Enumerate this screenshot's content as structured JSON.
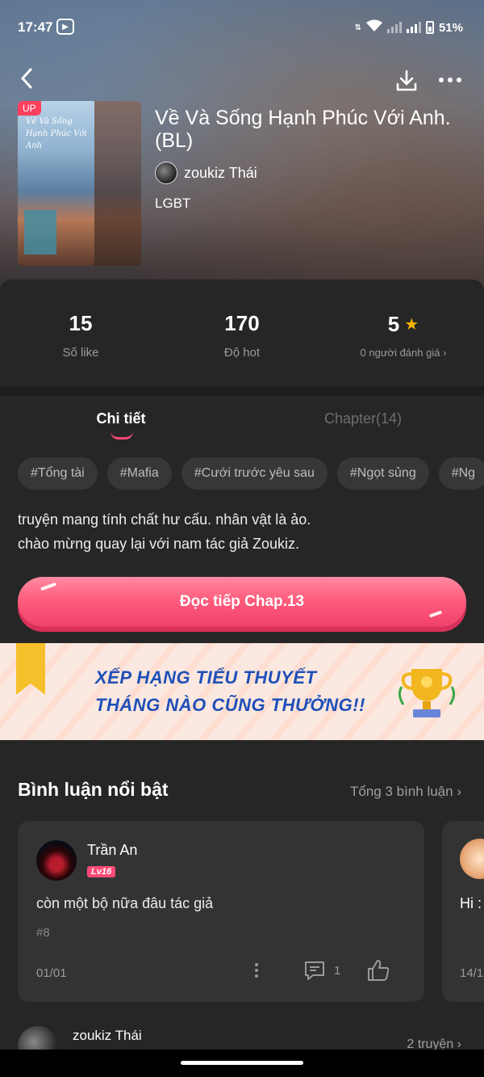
{
  "status": {
    "time": "17:47",
    "battery": "51%"
  },
  "header": {
    "back_icon": "chevron-left-icon",
    "download_icon": "download-icon",
    "more_icon": "more-dots-icon"
  },
  "story": {
    "badge": "UP",
    "cover_title": "Về Và Sống Hạnh Phúc Với Anh",
    "title": "Về Và Sống Hạnh Phúc Với Anh. (BL)",
    "author": "zoukiz Thái",
    "genre": "LGBT"
  },
  "stats": {
    "likes_value": "15",
    "likes_label": "Số like",
    "hot_value": "170",
    "hot_label": "Độ hot",
    "rating_value": "5",
    "rating_label": "0 người đánh giá",
    "star_color": "#f4b400"
  },
  "tabs": {
    "detail": "Chi tiết",
    "chapters": "Chapter(14)"
  },
  "tags": [
    "#Tổng tài",
    "#Mafia",
    "#Cưới trước yêu sau",
    "#Ngọt sủng",
    "#Ng"
  ],
  "description": {
    "line1": "truyện mang tính chất hư cấu. nhân vật là ảo.",
    "line2": "chào mừng quay lại với nam tác giả Zoukiz."
  },
  "read_button": {
    "label": "Đọc tiếp Chap.13",
    "color": "#ff5d7e"
  },
  "banner": {
    "line1": "XẾP HẠNG TIỂU THUYẾT",
    "line2": "THÁNG NÀO CŨNG THƯỞNG!!"
  },
  "comments": {
    "section_title": "Bình luận nổi bật",
    "total_link": "Tổng 3 bình luận",
    "items": [
      {
        "user": "Trần An",
        "level": "Lv16",
        "text": "còn một bộ nữa đâu tác giả",
        "num": "#8",
        "date": "01/01",
        "replies": "1"
      },
      {
        "text": "Hi :",
        "date": "14/1"
      }
    ]
  },
  "author_footer": {
    "name": "zoukiz Thái",
    "link": "2 truyện"
  }
}
